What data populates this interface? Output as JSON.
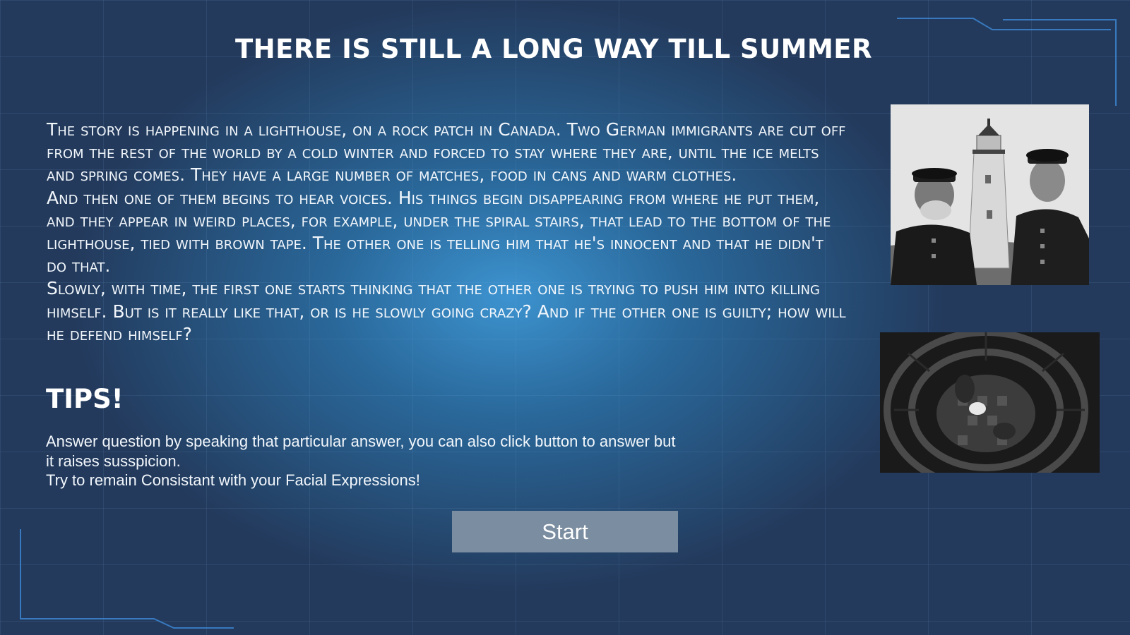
{
  "title": "THERE IS STILL A LONG WAY TILL SUMMER",
  "story": {
    "paragraphs": [
      "The story is happening in a lighthouse, on a rock patch in Canada. Two German immigrants are cut off from the rest of the world by a cold winter and forced to stay where they are, until the ice melts and spring comes. They have a large number of matches, food in cans and warm clothes.",
      "And then one of them begins to hear voices. His things begin disappearing from where he put them, and they appear in weird places, for example, under the spiral stairs, that lead to the bottom of the lighthouse, tied with brown tape. The other one is telling him that he's innocent and that he didn't do that.",
      "Slowly, with time, the first one starts thinking that the other one is trying to push him into killing himself. But is it really like that, or is he slowly going crazy? And if the other one is guilty; how will he defend himself?"
    ]
  },
  "tips": {
    "heading": "TIPS!",
    "lines": [
      "Answer question by speaking that particular answer, you can also click button to answer but it raises susspicion.",
      "Try to remain Consistant with your Facial Expressions!"
    ]
  },
  "start_button": {
    "label": "Start"
  },
  "images": [
    {
      "icon": "lighthouse-keepers-photo"
    },
    {
      "icon": "spiral-staircase-photo"
    }
  ],
  "colors": {
    "background": "#233a5c",
    "glow": "#3e98d6",
    "accent_line": "#3d8ad8",
    "button": "#7b8da0",
    "text": "#ffffff"
  }
}
